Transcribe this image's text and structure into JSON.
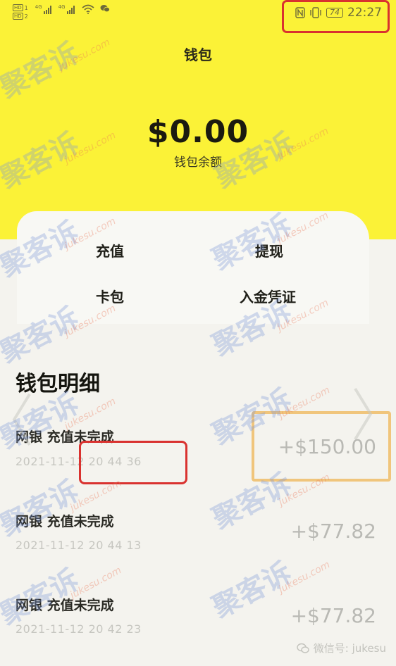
{
  "status_bar": {
    "sim1_tag": "HD",
    "sim1_num": "1",
    "sim2_tag": "HD",
    "sim2_num": "2",
    "network1": "4G",
    "network2": "4G",
    "battery": "74",
    "time": "22:27"
  },
  "wallet": {
    "title": "钱包",
    "balance": "$0.00",
    "balance_label": "钱包余额"
  },
  "actions": {
    "recharge": "充值",
    "withdraw": "提现",
    "card_pack": "卡包",
    "deposit_voucher": "入金凭证"
  },
  "details": {
    "title": "钱包明细",
    "rows": [
      {
        "title": "网银 充值未完成",
        "time": "2021-11-12 20 44 36",
        "amount": "+$150.00"
      },
      {
        "title": "网银 充值未完成",
        "time": "2021-11-12 20 44 13",
        "amount": "+$77.82"
      },
      {
        "title": "网银 充值未完成",
        "time": "2021-11-12 20 42 23",
        "amount": "+$77.82"
      }
    ]
  },
  "watermark": {
    "text": "聚客诉",
    "domain": "jukesu.com"
  },
  "footer": {
    "label": "微信号: jukesu"
  },
  "colors": {
    "header_yellow": "#fbf237",
    "highlight_red": "#d9322f",
    "highlight_gold": "#f0c57c",
    "background": "#f4f3ee"
  },
  "icons": {
    "status_left": [
      "wifi-icon",
      "wechat-icon"
    ],
    "status_right": [
      "nfc-icon",
      "vibrate-icon",
      "battery-icon"
    ],
    "footer": "wechat-icon"
  }
}
